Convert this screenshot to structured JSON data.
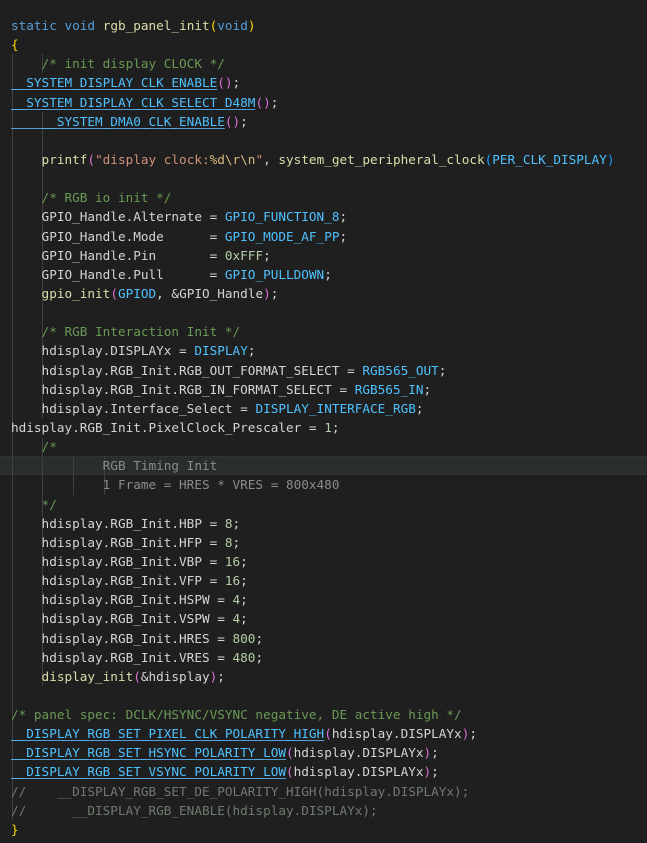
{
  "editor": {
    "theme_colors": {
      "background": "#1f1f1f",
      "keyword": "#569cd6",
      "function": "#dcdcaa",
      "macro": "#4fc1ff",
      "variable": "#9cdcfe",
      "string": "#ce9178",
      "number": "#b5cea8",
      "comment": "#6a9955",
      "bracket_pair_1": "#ffd700",
      "bracket_pair_2": "#da70d6",
      "bracket_pair_3": "#179fff"
    },
    "current_line_index": 23,
    "lines": [
      {
        "indent": 0,
        "tokens": [
          {
            "t": "static ",
            "c": "keyword"
          },
          {
            "t": "void ",
            "c": "keyword"
          },
          {
            "t": "rgb_panel_init",
            "c": "function"
          },
          {
            "t": "(",
            "c": "paren-gold"
          },
          {
            "t": "void",
            "c": "keyword"
          },
          {
            "t": ")",
            "c": "paren-gold"
          }
        ]
      },
      {
        "indent": 0,
        "tokens": [
          {
            "t": "{",
            "c": "paren-gold"
          }
        ]
      },
      {
        "indent": 2,
        "tokens": [
          {
            "t": "    /* init display CLOCK */",
            "c": "comment"
          }
        ]
      },
      {
        "indent": 1,
        "tokens": [
          {
            "t": "__SYSTEM_DISPLAY_CLK_ENABLE",
            "c": "macro-ul"
          },
          {
            "t": "()",
            "c": "paren"
          },
          {
            "t": ";",
            "c": "punct"
          }
        ]
      },
      {
        "indent": 1,
        "tokens": [
          {
            "t": "__SYSTEM_DISPLAY_CLK_SELECT_D48M",
            "c": "macro-ul"
          },
          {
            "t": "()",
            "c": "paren"
          },
          {
            "t": ";",
            "c": "punct"
          }
        ]
      },
      {
        "indent": 2,
        "tokens": [
          {
            "t": "    __SYSTEM_DMA0_CLK_ENABLE",
            "c": "macro-ul"
          },
          {
            "t": "()",
            "c": "paren"
          },
          {
            "t": ";",
            "c": "punct"
          }
        ]
      },
      {
        "indent": 2,
        "tokens": []
      },
      {
        "indent": 2,
        "tokens": [
          {
            "t": "    printf",
            "c": "function"
          },
          {
            "t": "(",
            "c": "paren"
          },
          {
            "t": "\"display clock:",
            "c": "string"
          },
          {
            "t": "%d\\r\\n",
            "c": "escape"
          },
          {
            "t": "\"",
            "c": "string"
          },
          {
            "t": ", ",
            "c": "punct"
          },
          {
            "t": "system_get_peripheral_clock",
            "c": "function"
          },
          {
            "t": "(",
            "c": "paren-blue"
          },
          {
            "t": "PER_CLK_DISPLAY",
            "c": "macro"
          },
          {
            "t": ")",
            "c": "paren-blue"
          }
        ]
      },
      {
        "indent": 2,
        "tokens": []
      },
      {
        "indent": 2,
        "tokens": [
          {
            "t": "    /* RGB io init */",
            "c": "comment"
          }
        ]
      },
      {
        "indent": 2,
        "tokens": [
          {
            "t": "    GPIO_Handle.Alternate",
            "c": "plain"
          },
          {
            "t": " = ",
            "c": "punct"
          },
          {
            "t": "GPIO_FUNCTION_8",
            "c": "macro"
          },
          {
            "t": ";",
            "c": "punct"
          }
        ]
      },
      {
        "indent": 2,
        "tokens": [
          {
            "t": "    GPIO_Handle.Mode",
            "c": "plain"
          },
          {
            "t": "      = ",
            "c": "punct"
          },
          {
            "t": "GPIO_MODE_AF_PP",
            "c": "macro"
          },
          {
            "t": ";",
            "c": "punct"
          }
        ]
      },
      {
        "indent": 2,
        "tokens": [
          {
            "t": "    GPIO_Handle.Pin",
            "c": "plain"
          },
          {
            "t": "       = ",
            "c": "punct"
          },
          {
            "t": "0xFFF",
            "c": "number"
          },
          {
            "t": ";",
            "c": "punct"
          }
        ]
      },
      {
        "indent": 2,
        "tokens": [
          {
            "t": "    GPIO_Handle.Pull",
            "c": "plain"
          },
          {
            "t": "      = ",
            "c": "punct"
          },
          {
            "t": "GPIO_PULLDOWN",
            "c": "macro"
          },
          {
            "t": ";",
            "c": "punct"
          }
        ]
      },
      {
        "indent": 2,
        "tokens": [
          {
            "t": "    gpio_init",
            "c": "function"
          },
          {
            "t": "(",
            "c": "paren"
          },
          {
            "t": "GPIOD",
            "c": "macro"
          },
          {
            "t": ", &",
            "c": "punct"
          },
          {
            "t": "GPIO_Handle",
            "c": "plain"
          },
          {
            "t": ")",
            "c": "paren"
          },
          {
            "t": ";",
            "c": "punct"
          }
        ]
      },
      {
        "indent": 2,
        "tokens": []
      },
      {
        "indent": 2,
        "tokens": [
          {
            "t": "    /* RGB Interaction Init */",
            "c": "comment"
          }
        ]
      },
      {
        "indent": 2,
        "tokens": [
          {
            "t": "    hdisplay.DISPLAYx",
            "c": "plain"
          },
          {
            "t": " = ",
            "c": "punct"
          },
          {
            "t": "DISPLAY",
            "c": "macro"
          },
          {
            "t": ";",
            "c": "punct"
          }
        ]
      },
      {
        "indent": 2,
        "tokens": [
          {
            "t": "    hdisplay.RGB_Init.RGB_OUT_FORMAT_SELECT",
            "c": "plain"
          },
          {
            "t": " = ",
            "c": "punct"
          },
          {
            "t": "RGB565_OUT",
            "c": "macro"
          },
          {
            "t": ";",
            "c": "punct"
          }
        ]
      },
      {
        "indent": 2,
        "tokens": [
          {
            "t": "    hdisplay.RGB_Init.RGB_IN_FORMAT_SELECT",
            "c": "plain"
          },
          {
            "t": " = ",
            "c": "punct"
          },
          {
            "t": "RGB565_IN",
            "c": "macro"
          },
          {
            "t": ";",
            "c": "punct"
          }
        ]
      },
      {
        "indent": 2,
        "tokens": [
          {
            "t": "    hdisplay.Interface_Select",
            "c": "plain"
          },
          {
            "t": " = ",
            "c": "punct"
          },
          {
            "t": "DISPLAY_INTERFACE_RGB",
            "c": "macro"
          },
          {
            "t": ";",
            "c": "punct"
          }
        ]
      },
      {
        "indent": 1,
        "tokens": [
          {
            "t": "hdisplay.RGB_Init.PixelClock_Prescaler",
            "c": "plain"
          },
          {
            "t": " = ",
            "c": "punct"
          },
          {
            "t": "1",
            "c": "number"
          },
          {
            "t": ";",
            "c": "punct"
          }
        ]
      },
      {
        "indent": 2,
        "tokens": [
          {
            "t": "    /*",
            "c": "comment"
          }
        ]
      },
      {
        "indent": 4,
        "tokens": [
          {
            "t": "            RGB Timing Init",
            "c": "disabled"
          }
        ]
      },
      {
        "indent": 4,
        "tokens": [
          {
            "t": "            1 Frame = HRES * VRES = 800x480",
            "c": "disabled"
          }
        ]
      },
      {
        "indent": 2,
        "tokens": [
          {
            "t": "    */",
            "c": "comment"
          }
        ]
      },
      {
        "indent": 2,
        "tokens": [
          {
            "t": "    hdisplay.RGB_Init.HBP",
            "c": "plain"
          },
          {
            "t": " = ",
            "c": "punct"
          },
          {
            "t": "8",
            "c": "number"
          },
          {
            "t": ";",
            "c": "punct"
          }
        ]
      },
      {
        "indent": 2,
        "tokens": [
          {
            "t": "    hdisplay.RGB_Init.HFP",
            "c": "plain"
          },
          {
            "t": " = ",
            "c": "punct"
          },
          {
            "t": "8",
            "c": "number"
          },
          {
            "t": ";",
            "c": "punct"
          }
        ]
      },
      {
        "indent": 2,
        "tokens": [
          {
            "t": "    hdisplay.RGB_Init.VBP",
            "c": "plain"
          },
          {
            "t": " = ",
            "c": "punct"
          },
          {
            "t": "16",
            "c": "number"
          },
          {
            "t": ";",
            "c": "punct"
          }
        ]
      },
      {
        "indent": 2,
        "tokens": [
          {
            "t": "    hdisplay.RGB_Init.VFP",
            "c": "plain"
          },
          {
            "t": " = ",
            "c": "punct"
          },
          {
            "t": "16",
            "c": "number"
          },
          {
            "t": ";",
            "c": "punct"
          }
        ]
      },
      {
        "indent": 2,
        "tokens": [
          {
            "t": "    hdisplay.RGB_Init.HSPW",
            "c": "plain"
          },
          {
            "t": " = ",
            "c": "punct"
          },
          {
            "t": "4",
            "c": "number"
          },
          {
            "t": ";",
            "c": "punct"
          }
        ]
      },
      {
        "indent": 2,
        "tokens": [
          {
            "t": "    hdisplay.RGB_Init.VSPW",
            "c": "plain"
          },
          {
            "t": " = ",
            "c": "punct"
          },
          {
            "t": "4",
            "c": "number"
          },
          {
            "t": ";",
            "c": "punct"
          }
        ]
      },
      {
        "indent": 2,
        "tokens": [
          {
            "t": "    hdisplay.RGB_Init.HRES",
            "c": "plain"
          },
          {
            "t": " = ",
            "c": "punct"
          },
          {
            "t": "800",
            "c": "number"
          },
          {
            "t": ";",
            "c": "punct"
          }
        ]
      },
      {
        "indent": 2,
        "tokens": [
          {
            "t": "    hdisplay.RGB_Init.VRES",
            "c": "plain"
          },
          {
            "t": " = ",
            "c": "punct"
          },
          {
            "t": "480",
            "c": "number"
          },
          {
            "t": ";",
            "c": "punct"
          }
        ]
      },
      {
        "indent": 2,
        "tokens": [
          {
            "t": "    display_init",
            "c": "function"
          },
          {
            "t": "(",
            "c": "paren"
          },
          {
            "t": "&hdisplay",
            "c": "plain"
          },
          {
            "t": ")",
            "c": "paren"
          },
          {
            "t": ";",
            "c": "punct"
          }
        ]
      },
      {
        "indent": 1,
        "tokens": []
      },
      {
        "indent": 1,
        "tokens": [
          {
            "t": "/* panel spec: DCLK/HSYNC/VSYNC negative, DE active high */",
            "c": "comment"
          }
        ]
      },
      {
        "indent": 1,
        "tokens": [
          {
            "t": "__DISPLAY_RGB_SET_PIXEL_CLK_POLARITY_HIGH",
            "c": "macro-ul"
          },
          {
            "t": "(",
            "c": "paren"
          },
          {
            "t": "hdisplay.DISPLAYx",
            "c": "plain"
          },
          {
            "t": ")",
            "c": "paren"
          },
          {
            "t": ";",
            "c": "punct"
          }
        ]
      },
      {
        "indent": 1,
        "tokens": [
          {
            "t": "__DISPLAY_RGB_SET_HSYNC_POLARITY_LOW",
            "c": "macro-ul"
          },
          {
            "t": "(",
            "c": "paren"
          },
          {
            "t": "hdisplay.DISPLAYx",
            "c": "plain"
          },
          {
            "t": ")",
            "c": "paren"
          },
          {
            "t": ";",
            "c": "punct"
          }
        ]
      },
      {
        "indent": 1,
        "tokens": [
          {
            "t": "__DISPLAY_RGB_SET_VSYNC_POLARITY_LOW",
            "c": "macro-ul"
          },
          {
            "t": "(",
            "c": "paren"
          },
          {
            "t": "hdisplay.DISPLAYx",
            "c": "plain"
          },
          {
            "t": ")",
            "c": "paren"
          },
          {
            "t": ";",
            "c": "punct"
          }
        ]
      },
      {
        "indent": 1,
        "tokens": [
          {
            "t": "//    __DISPLAY_RGB_SET_DE_POLARITY_HIGH(hdisplay.DISPLAYx);",
            "c": "disabled-comment"
          }
        ]
      },
      {
        "indent": 1,
        "tokens": [
          {
            "t": "//      __DISPLAY_RGB_ENABLE(hdisplay.DISPLAYx);",
            "c": "disabled-comment"
          }
        ]
      },
      {
        "indent": 0,
        "tokens": [
          {
            "t": "}",
            "c": "paren-gold"
          }
        ]
      }
    ]
  }
}
